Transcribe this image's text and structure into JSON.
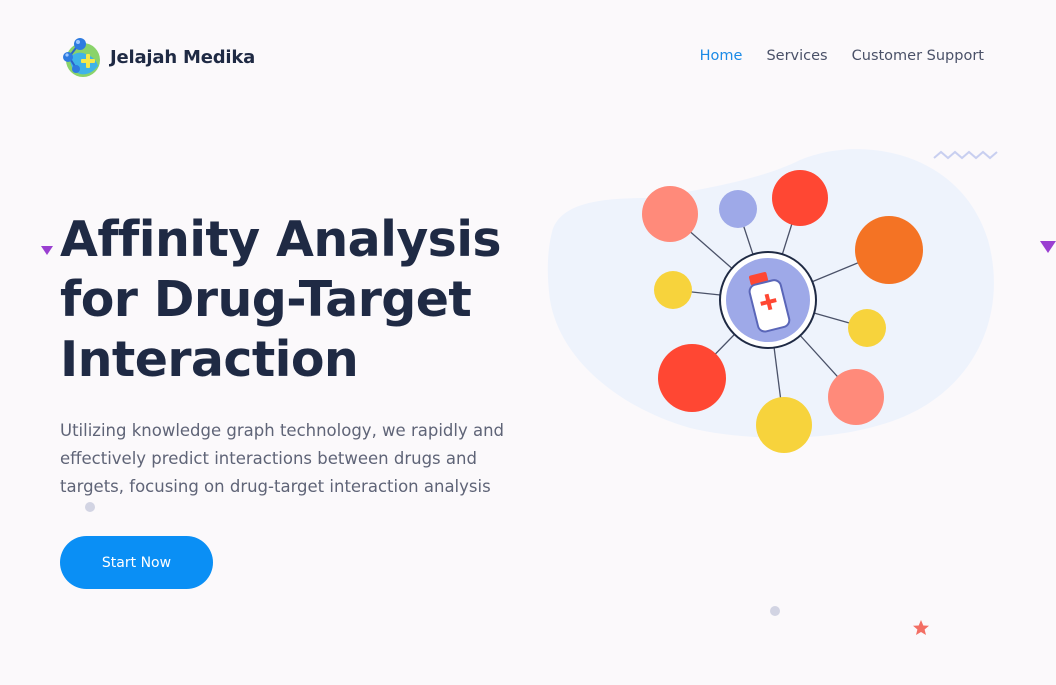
{
  "brand": {
    "name": "Jelajah Medika",
    "icon": "molecule-globe-icon"
  },
  "nav": {
    "items": [
      {
        "label": "Home",
        "active": true
      },
      {
        "label": "Services",
        "active": false
      },
      {
        "label": "Customer Support",
        "active": false
      }
    ]
  },
  "hero": {
    "title_lines": [
      "Affinity Analysis",
      "for Drug-Target",
      "Interaction"
    ],
    "description_lines": [
      "Utilizing knowledge graph technology, we rapidly and",
      "effectively predict interactions between drugs and",
      "targets, focusing on drug-target interaction analysis"
    ],
    "cta_label": "Start Now"
  },
  "illustration": {
    "center_icon": "medicine-bottle-icon",
    "node_colors": {
      "salmon": "#ff8a7a",
      "lavender": "#9ea9e8",
      "red": "#ff4733",
      "orange": "#f47324",
      "yellow": "#f7d33c"
    }
  },
  "colors": {
    "accent": "#0a8ff5",
    "nav_active": "#1a8ae6",
    "heading": "#1f2a44",
    "body_text": "#5f6477",
    "background": "#fbf9fb",
    "blob": "#eef3fc"
  }
}
